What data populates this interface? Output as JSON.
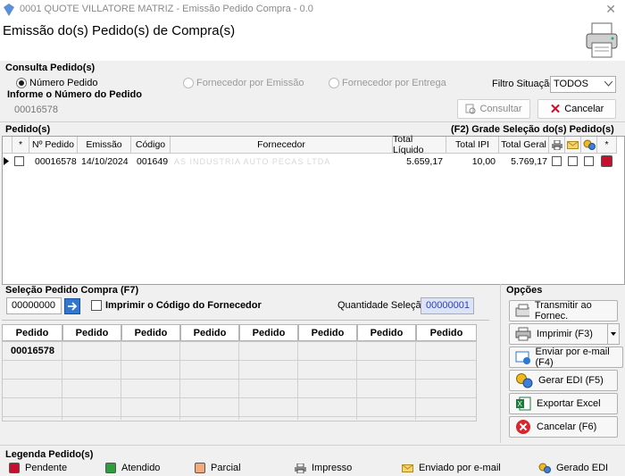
{
  "window": {
    "title": "0001 QUOTE VILLATORE MATRIZ - Emissão Pedido Compra - 0.0",
    "close_glyph": "✕"
  },
  "header": {
    "title": "Emissão do(s) Pedido(s) de Compra(s)",
    "icon": "printer-icon"
  },
  "consulta": {
    "section_label": "Consulta Pedido(s)",
    "radio_numero": "Número Pedido",
    "radio_emissao": "Fornecedor por Emissão",
    "radio_entrega": "Fornecedor por Entrega",
    "filtro_label": "Filtro Situação:",
    "filtro_value": "TODOS",
    "informe_label": "Informe o Número do Pedido",
    "numero_value": "00016578",
    "consultar_label": "Consultar",
    "cancelar_label": "Cancelar"
  },
  "pedidos": {
    "section_label": "Pedido(s)",
    "right_label": "(F2) Grade Seleção do(s) Pedido(s)",
    "columns": [
      "*",
      "Nº Pedido",
      "Emissão",
      "Código",
      "Fornecedor",
      "Total Líquido",
      "Total IPI",
      "Total Geral",
      "*"
    ],
    "row": {
      "numero": "00016578",
      "emissao": "14/10/2024",
      "codigo": "001649",
      "fornecedor": "AS INDUSTRIA AUTO PECAS LTDA",
      "total_liquido": "5.659,17",
      "total_ipi": "10,00",
      "total_geral": "5.769,17"
    }
  },
  "selecao": {
    "section_label": "Seleção Pedido Compra (F7)",
    "input_value": "00000000",
    "imprimir_label": "Imprimir o Código do Fornecedor",
    "quantidade_label": "Quantidade Seleção:",
    "quantidade_value": "00000001",
    "col_header": "Pedido",
    "first_value": "00016578"
  },
  "opcoes": {
    "section_label": "Opções",
    "transmitir": "Transmitir ao Fornec.",
    "imprimir": "Imprimir (F3)",
    "enviar": "Enviar por e-mail (F4)",
    "gerar_edi": "Gerar EDI (F5)",
    "exportar": "Exportar Excel",
    "cancelar": "Cancelar (F6)"
  },
  "legenda": {
    "section_label": "Legenda Pedido(s)",
    "pendente": "Pendente",
    "atendido": "Atendido",
    "parcial": "Parcial",
    "impresso": "Impresso",
    "enviado": "Enviado por e-mail",
    "gerado": "Gerado EDI"
  },
  "colors": {
    "pendente": "#c8102e",
    "atendido": "#2e9e3a",
    "parcial": "#f4a97a",
    "quantidade_bg": "#dde3f7"
  }
}
